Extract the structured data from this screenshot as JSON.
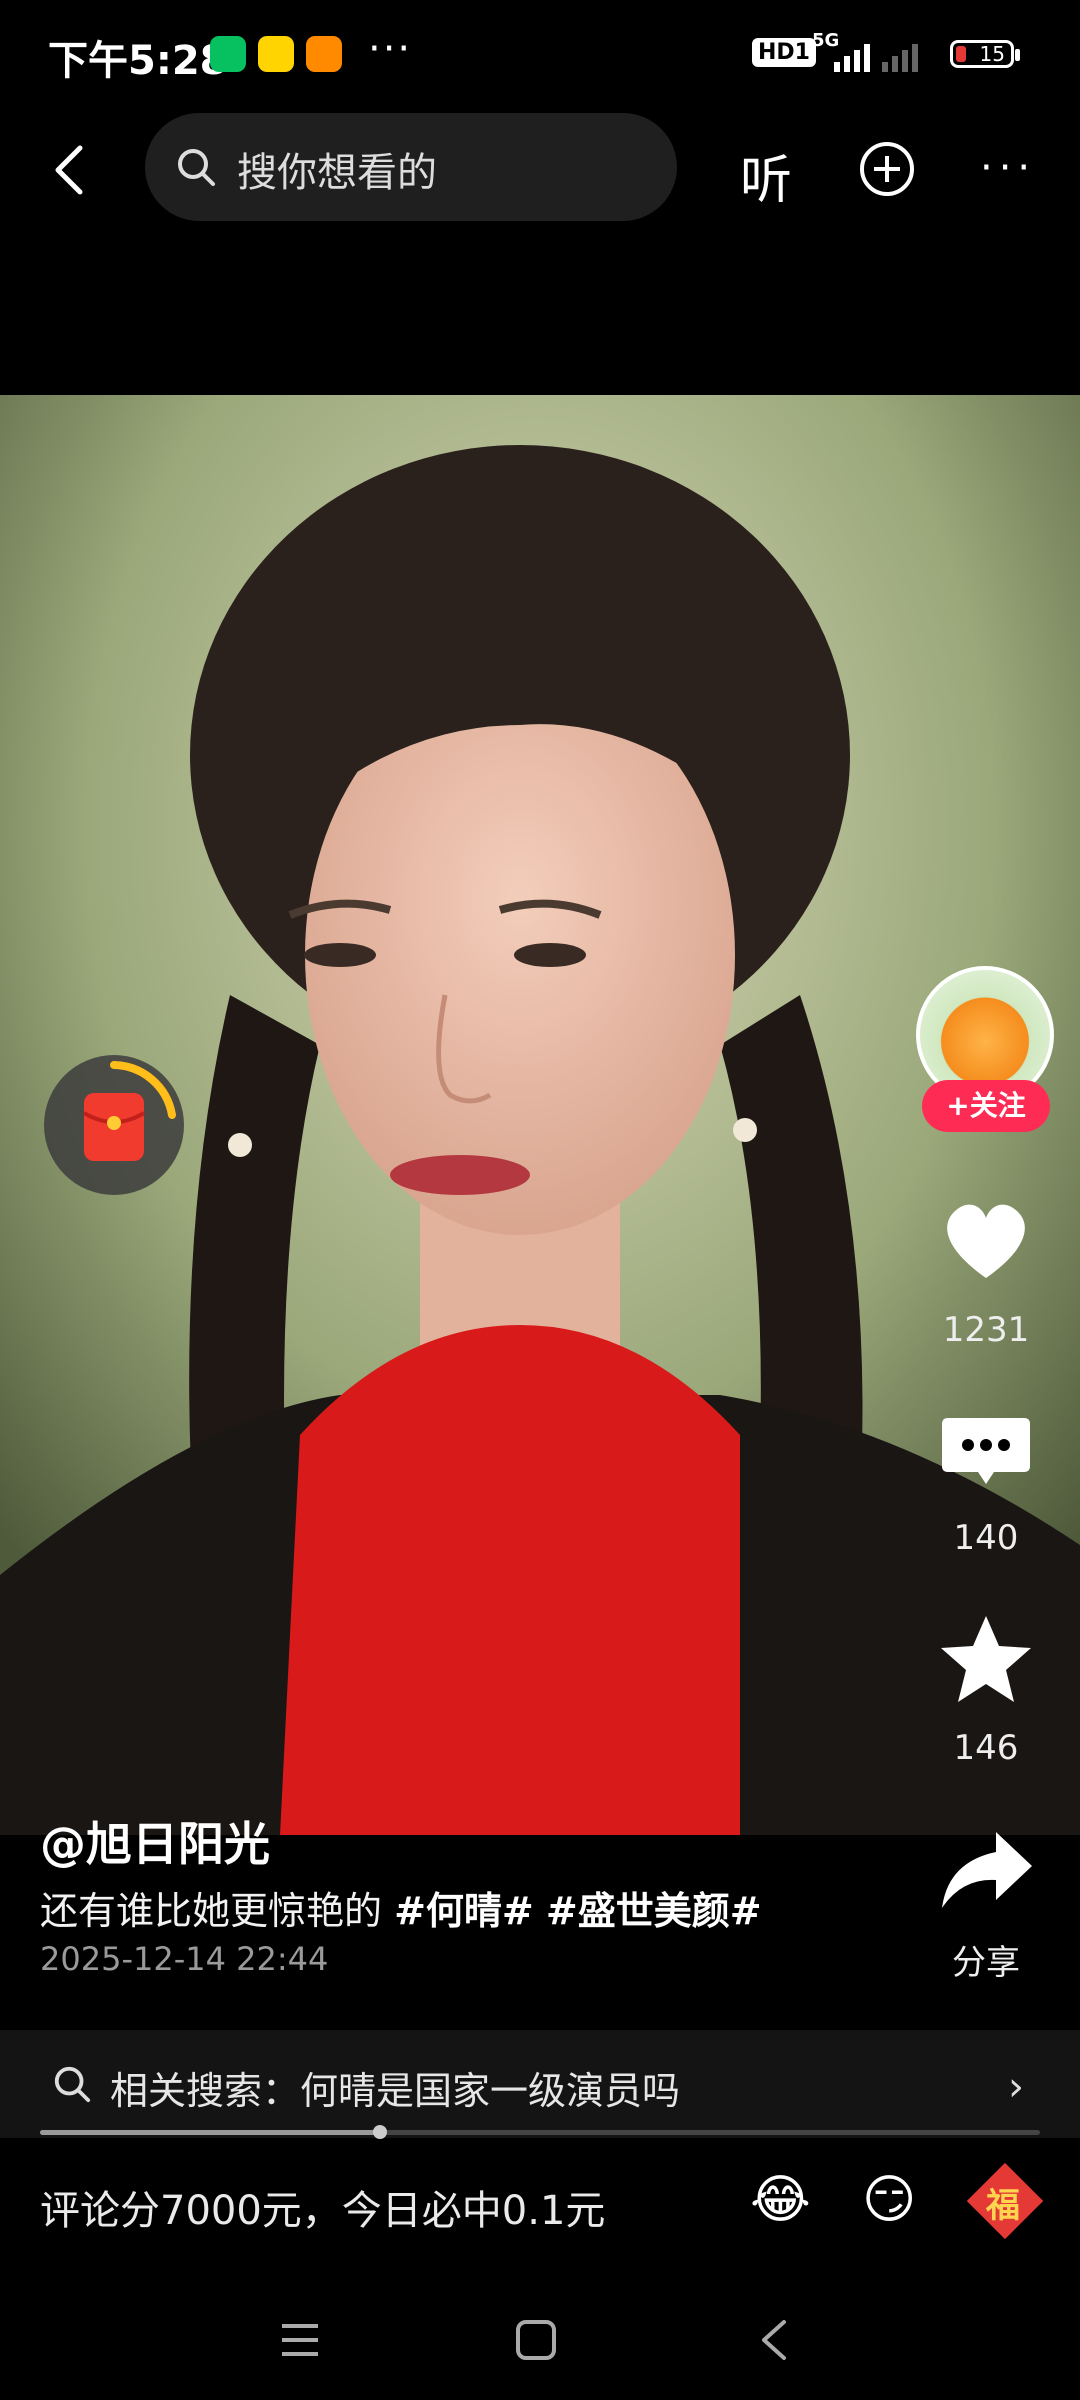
{
  "status_bar": {
    "time": "下午5:28",
    "apps": [
      "wechat-icon",
      "app-yellow-icon",
      "taobao-icon"
    ],
    "more": "···",
    "hd": "HD1",
    "net": "5G",
    "battery": "15"
  },
  "nav": {
    "search_placeholder": "搜你想看的",
    "listen": "听"
  },
  "author": {
    "handle": "@旭日阳光",
    "follow": "+关注"
  },
  "caption": {
    "text": "还有谁比她更惊艳的 ",
    "tag1": "#何晴#",
    "tag2": "#盛世美颜#"
  },
  "post_time": "2025-12-14 22:44",
  "actions": {
    "likes": "1231",
    "comments": "140",
    "favorites": "146",
    "share": "分享"
  },
  "related_search": "相关搜索：何晴是国家一级演员吗",
  "progress": 0.34,
  "comment_bar": {
    "text": "评论分7000元，今日必中0.1元",
    "emojis": [
      "😂",
      "😏",
      "福"
    ]
  },
  "colors": {
    "accent": "#fe2c55",
    "background": "#000000"
  }
}
